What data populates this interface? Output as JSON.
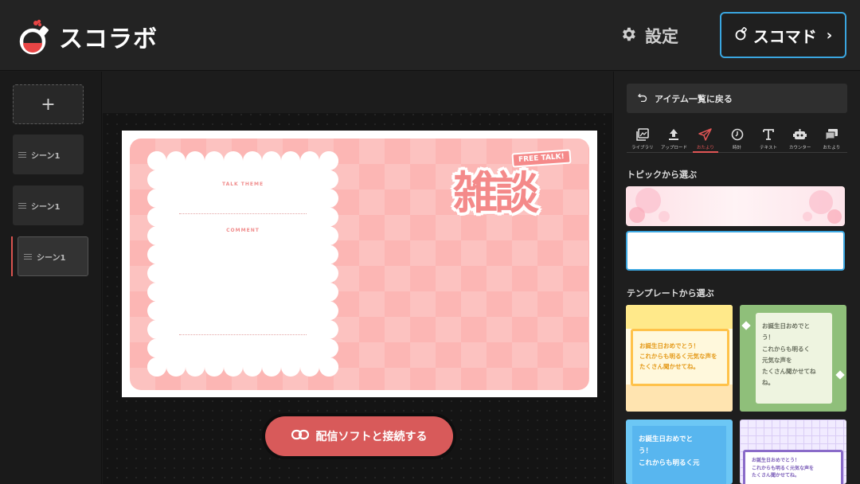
{
  "header": {
    "logo_text": "スコラボ",
    "settings_label": "設定",
    "scomad_label": "スコマド"
  },
  "scenes": {
    "add_label": "+",
    "items": [
      {
        "label": "シーン1"
      },
      {
        "label": "シーン1"
      },
      {
        "label": "シーン1"
      }
    ]
  },
  "canvas": {
    "talk_theme_label": "TALK THEME",
    "comment_label": "COMMENT",
    "free_talk_label": "FREE TALK!",
    "title_text": "雑談"
  },
  "connect_button_label": "配信ソフトと接続する",
  "right_panel": {
    "back_label": "アイテム一覧に戻る",
    "tabs": [
      {
        "label": "ライブラリ",
        "icon": "library-icon"
      },
      {
        "label": "アップロード",
        "icon": "upload-icon"
      },
      {
        "label": "おたより",
        "icon": "paper-plane-icon"
      },
      {
        "label": "時計",
        "icon": "clock-icon"
      },
      {
        "label": "テキスト",
        "icon": "text-icon"
      },
      {
        "label": "カウンター",
        "icon": "robot-icon"
      },
      {
        "label": "おたより",
        "icon": "messages-icon"
      }
    ],
    "active_tab": 2,
    "topic_section_title": "トピックから選ぶ",
    "template_section_title": "テンプレートから選ぶ",
    "templates": [
      {
        "text": "お誕生日おめでとう！\nこれからも明るく元気な声を\nたくさん聞かせてね。"
      },
      {
        "text": "お誕生日おめでと\nう！\nこれからも明るく\n元気な声を\nたくさん聞かせてね\nね。"
      },
      {
        "text": "お誕生日おめでと\nう！\nこれからも明るく元"
      },
      {
        "text": "お誕生日おめでとう！\nこれからも明るく元気な声を\nたくさん聞かせてね。"
      }
    ]
  },
  "colors": {
    "accent_red": "#d85a5a",
    "accent_blue": "#3aa6e0",
    "card_pink": "#fcb6b4"
  }
}
